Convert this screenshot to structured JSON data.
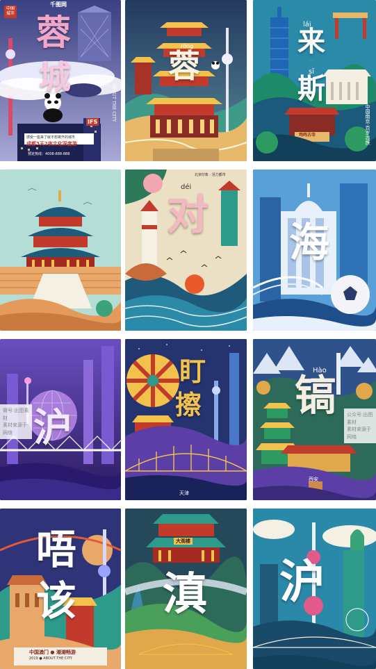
{
  "tiles": {
    "t1": {
      "badge": "中国\n城市",
      "brand": "千图网",
      "c1": "蓉",
      "c2": "城",
      "sign": "IFS",
      "vert_side": "ABOUT THE CITY",
      "caption": "成都3天2夜文化深度游",
      "caption_small": "感受一座来了就不想离开的城市",
      "price_label": "预定热线：4008-888-888"
    },
    "t2": {
      "c1": "蓉",
      "pinyin": "róng"
    },
    "t3": {
      "c1": "来",
      "c2": "斯",
      "py1": "lái",
      "py2": "sī",
      "sign": "鸡鸣古寺",
      "vert": "中国南京·百岁古族"
    },
    "t4": {},
    "t5": {
      "c1": "对",
      "pinyin": "déi",
      "top_small": "北京印象 · 活力都市"
    },
    "t6": {
      "c1": "海"
    },
    "t7": {
      "c1": "沪",
      "watermark": "微号:出图素材\n素材来源于网络"
    },
    "t8": {
      "c1": "盯",
      "c2": "擦",
      "footer": "天津"
    },
    "t9": {
      "c1": "镐",
      "pinyin": "Hào",
      "footer": "西安",
      "watermark": "公众号:出图素材\n素材来源于网络"
    },
    "t10": {
      "c1": "唔",
      "c2": "该",
      "line1": "中国澳门 ● 潮潮畅游",
      "line2": "2019 ● ABOUT THE CITY"
    },
    "t11": {
      "c1": "滇",
      "sign": "大观楼"
    },
    "t12": {
      "c1": "沪"
    }
  },
  "colors": {
    "navy": "#1c2348",
    "teal": "#1f8a8c",
    "red": "#c23a2c",
    "gold": "#e0a84a",
    "purple": "#5b3fa6",
    "green": "#2d9a62"
  }
}
